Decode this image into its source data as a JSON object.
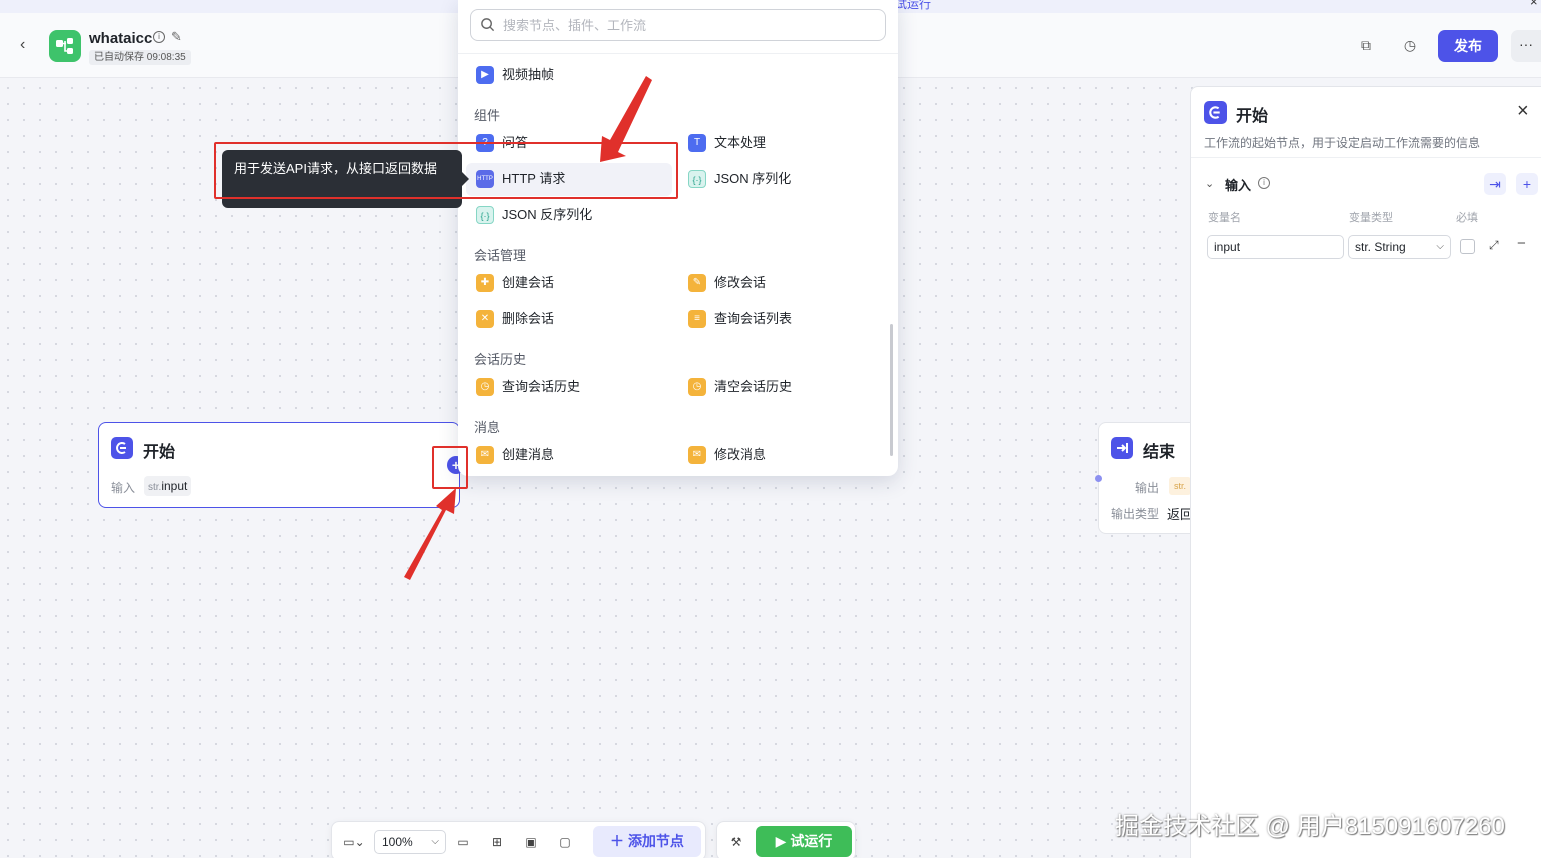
{
  "topbar": {
    "app_name": "whataicc",
    "autosave": "已自动保存 09:08:35",
    "publish_label": "发布",
    "more_label": "···",
    "top_hint": "试运行"
  },
  "picker": {
    "search_placeholder": "搜索节点、插件、工作流",
    "top_item": "视频抽帧",
    "groups": {
      "components": "组件",
      "conversation_mgmt": "会话管理",
      "conversation_history": "会话历史",
      "messages": "消息"
    },
    "items": {
      "qa": "问答",
      "text_processing": "文本处理",
      "http_request": "HTTP 请求",
      "json_serialize": "JSON 序列化",
      "json_deserialize": "JSON 反序列化",
      "create_conv": "创建会话",
      "modify_conv": "修改会话",
      "delete_conv": "删除会话",
      "list_conv": "查询会话列表",
      "query_history": "查询会话历史",
      "clear_history": "清空会话历史",
      "create_msg": "创建消息",
      "modify_msg": "修改消息"
    },
    "http_icon_text": "HTTP"
  },
  "tooltip": {
    "text": "用于发送API请求，从接口返回数据"
  },
  "start_node": {
    "title": "开始",
    "input_label": "输入",
    "param_type": "str.",
    "param_name": "input"
  },
  "end_node": {
    "title": "结束",
    "output_label": "输出",
    "output_tag": "str.",
    "output_type_label": "输出类型",
    "output_type_value": "返回"
  },
  "panel": {
    "title": "开始",
    "description": "工作流的起始节点，用于设定启动工作流需要的信息",
    "section_title": "输入",
    "col_name": "变量名",
    "col_type": "变量类型",
    "col_required": "必填",
    "var_name_value": "input",
    "var_type_value": "str. String"
  },
  "bottom": {
    "zoom": "100%",
    "add_node_label": "添加节点",
    "run_label": "试运行"
  },
  "watermark": "掘金技术社区 @ 用户815091607260",
  "colors": {
    "accent": "#4d53e8",
    "run_green": "#3ebd58",
    "annotation_red": "#e0302b"
  }
}
